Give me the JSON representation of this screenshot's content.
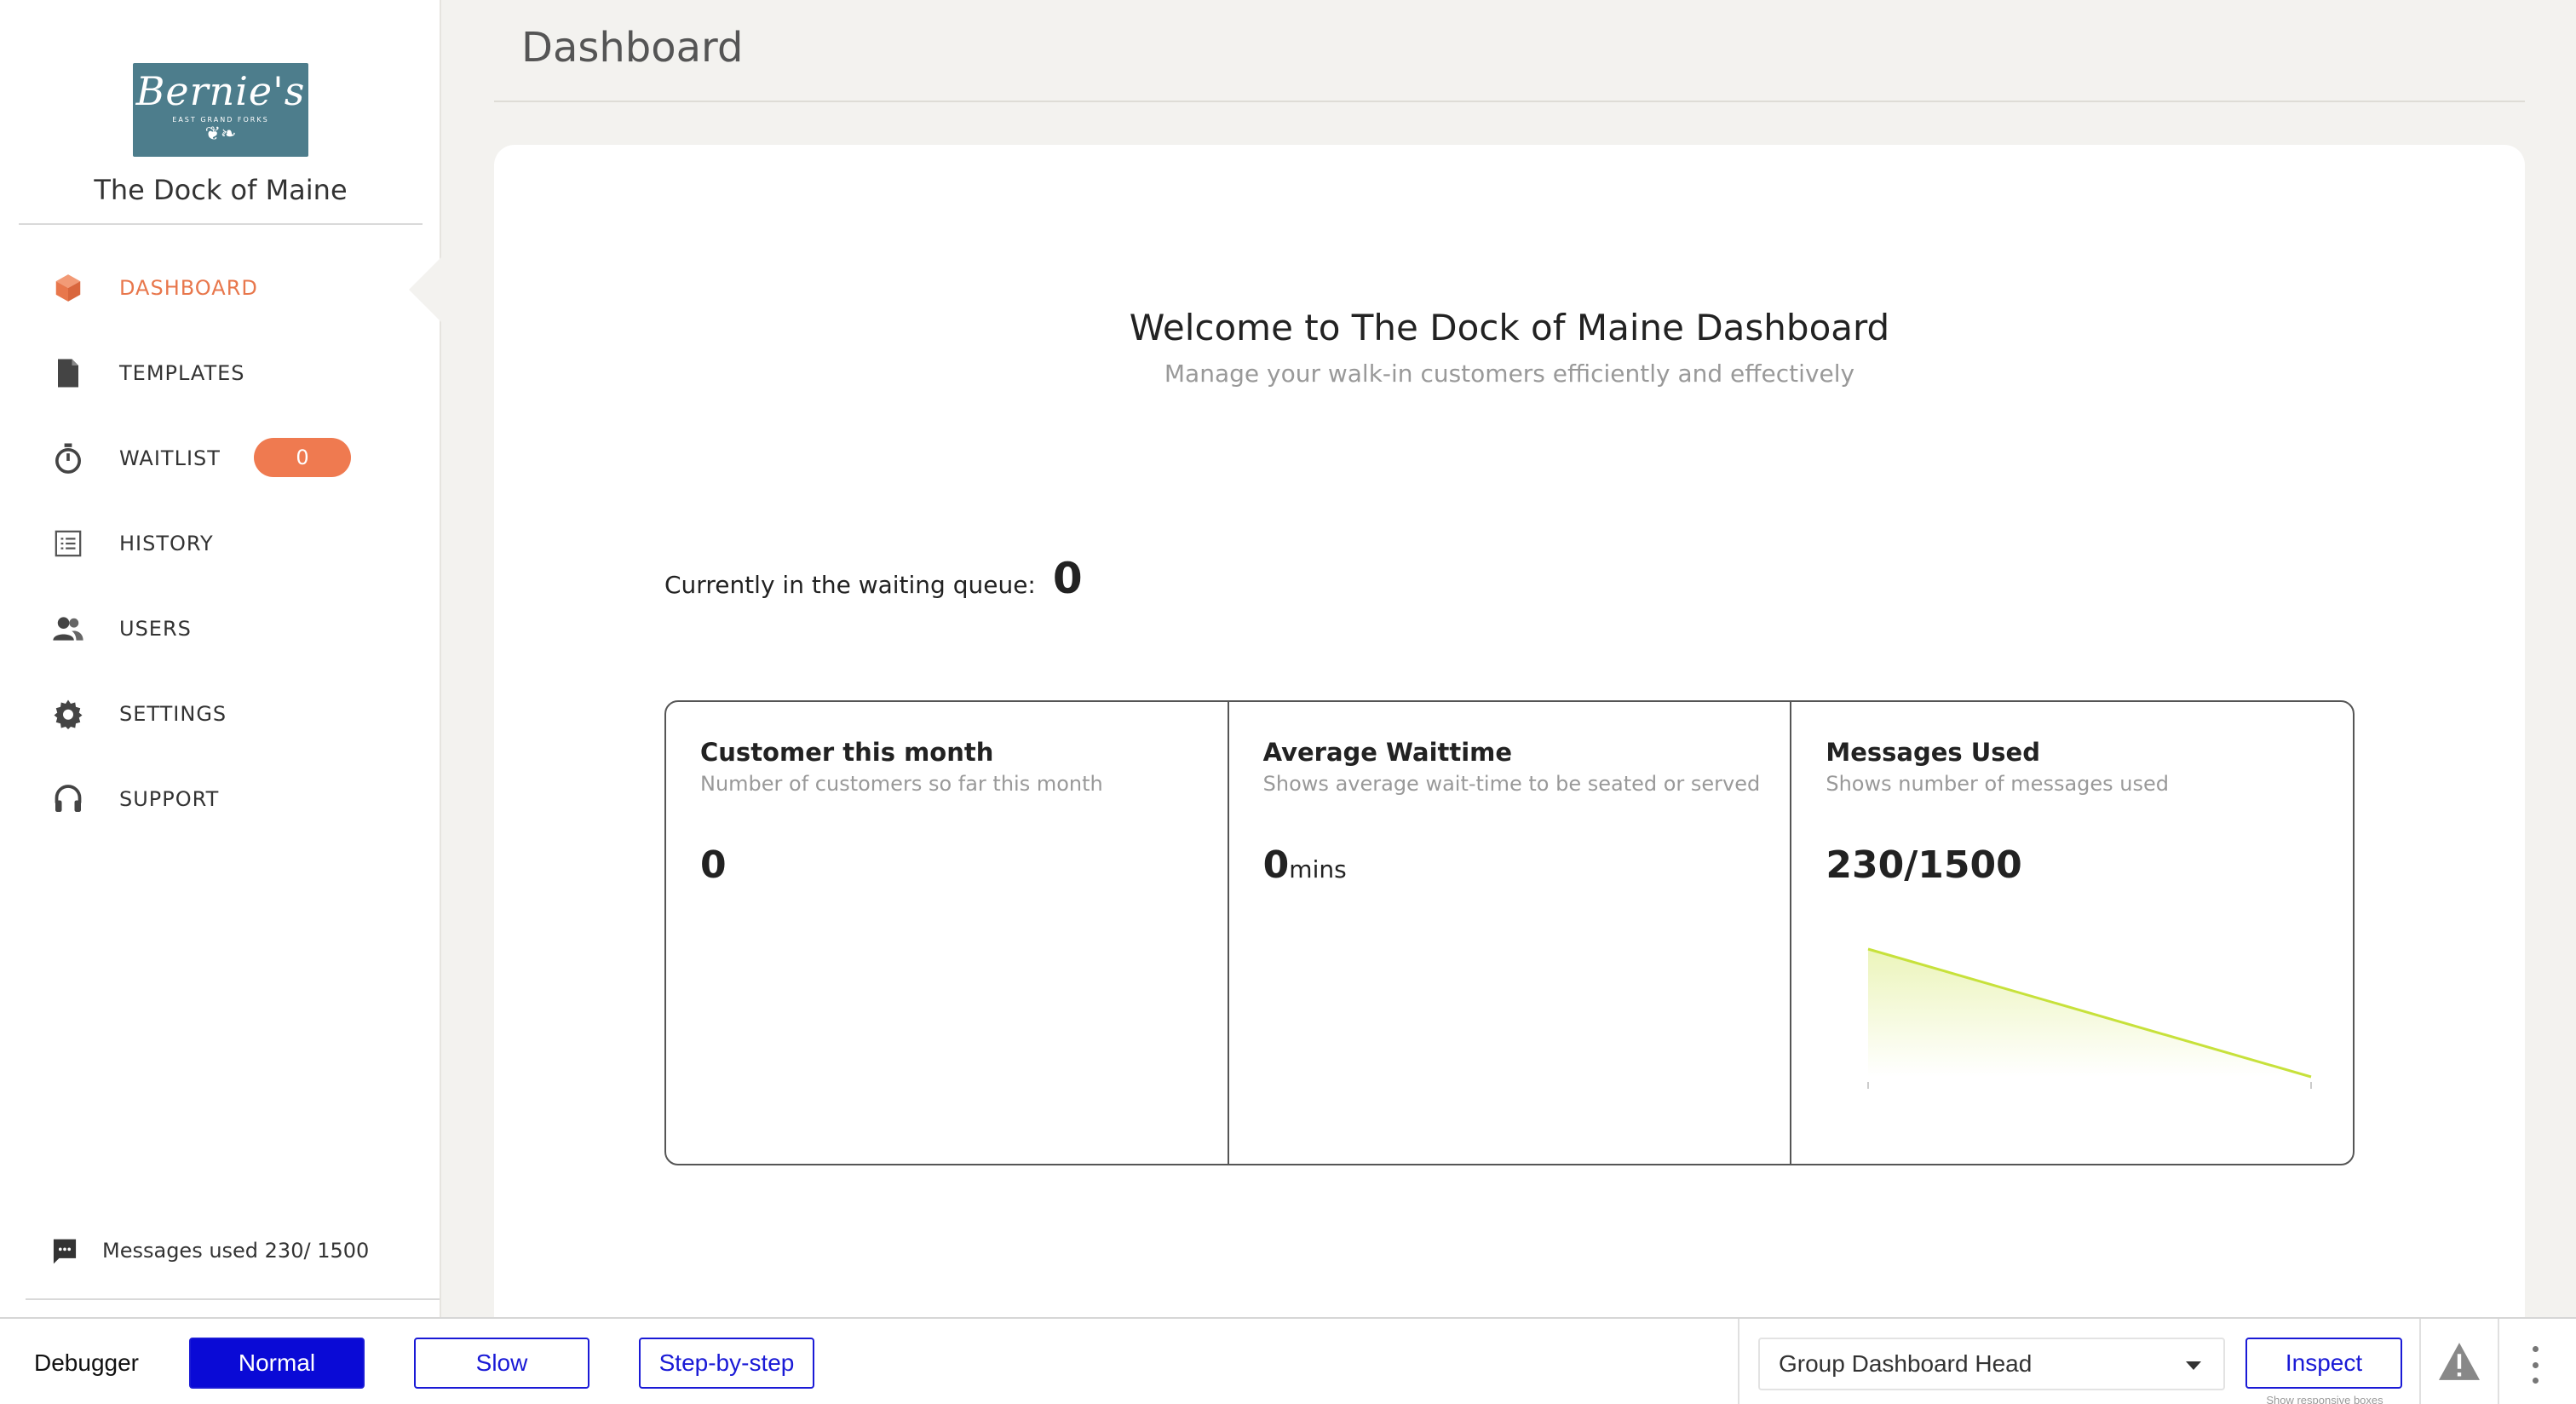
{
  "sidebar": {
    "logo": {
      "brand": "Bernie's",
      "subtitle": "EAST GRAND FORKS",
      "ornament": "❦❧"
    },
    "org_name": "The Dock of Maine",
    "items": [
      {
        "label": "DASHBOARD",
        "icon": "cube-icon",
        "active": true
      },
      {
        "label": "TEMPLATES",
        "icon": "document-icon",
        "active": false
      },
      {
        "label": "WAITLIST",
        "icon": "stopwatch-icon",
        "active": false,
        "badge": "0"
      },
      {
        "label": "HISTORY",
        "icon": "list-icon",
        "active": false
      },
      {
        "label": "USERS",
        "icon": "users-icon",
        "active": false
      },
      {
        "label": "SETTINGS",
        "icon": "gear-icon",
        "active": false
      },
      {
        "label": "SUPPORT",
        "icon": "headset-icon",
        "active": false
      }
    ],
    "messages_used": "Messages used  230/ 1500"
  },
  "header": {
    "title": "Dashboard"
  },
  "main": {
    "welcome_title": "Welcome to The Dock of Maine Dashboard",
    "welcome_subtitle": "Manage your walk-in customers efficiently and effectively",
    "queue_label": "Currently in the waiting queue:",
    "queue_value": "0",
    "stats": [
      {
        "title": "Customer this month",
        "description": "Number of customers so far this month",
        "value": "0",
        "unit": ""
      },
      {
        "title": "Average Waittime",
        "description": "Shows average wait-time to be seated or served",
        "value": "0",
        "unit": "mins"
      },
      {
        "title": "Messages Used",
        "description": "Shows number of messages used",
        "value": "230/1500",
        "unit": ""
      }
    ]
  },
  "chart_data": {
    "type": "area",
    "series": [
      {
        "values": [
          1,
          0
        ]
      }
    ],
    "ylim": [
      0,
      1
    ],
    "color": "#c7e13b"
  },
  "debugger": {
    "label": "Debugger",
    "buttons": [
      "Normal",
      "Slow",
      "Step-by-step"
    ],
    "select_value": "Group Dashboard Head",
    "inspect_label": "Inspect",
    "inspect_note": "Show responsive boxes"
  },
  "colors": {
    "accent": "#e8774c",
    "debug_blue": "#0a0ad6",
    "chart": "#c7e13b"
  }
}
